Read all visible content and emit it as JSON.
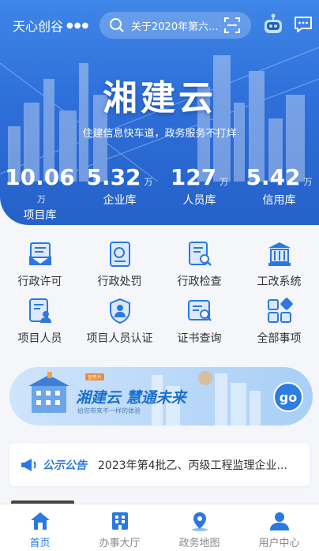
{
  "header": {
    "location": "天心创谷",
    "search_text": "关于2020年第六...",
    "icons": [
      "search-icon",
      "scan-icon",
      "robot-icon",
      "chat-icon"
    ]
  },
  "brand": {
    "title": "湘建云",
    "slogan": "住建信息快车道，政务服务不打烊"
  },
  "stats": [
    {
      "value": "10.06",
      "unit": "万",
      "label": "项目库"
    },
    {
      "value": "5.32",
      "unit": "万",
      "label": "企业库"
    },
    {
      "value": "127",
      "unit": "万",
      "label": "人员库"
    },
    {
      "value": "5.42",
      "unit": "万",
      "label": "信用库"
    }
  ],
  "services": [
    {
      "label": "行政许可",
      "icon": "license-icon"
    },
    {
      "label": "行政处罚",
      "icon": "penalty-icon"
    },
    {
      "label": "行政检查",
      "icon": "inspection-icon"
    },
    {
      "label": "工改系统",
      "icon": "government-building-icon"
    },
    {
      "label": "项目人员",
      "icon": "project-staff-icon"
    },
    {
      "label": "项目人员认证",
      "icon": "staff-verify-icon"
    },
    {
      "label": "证书查询",
      "icon": "certificate-search-icon"
    },
    {
      "label": "全部事项",
      "icon": "all-items-icon"
    }
  ],
  "banner": {
    "tag": "宣传片",
    "title": "湘建云  慧通未来",
    "subtitle": "给您带来不一样的体验",
    "go_label": "go"
  },
  "notice": {
    "badge": "公示公告",
    "text": "2023年第4批乙、丙级工程监理企业..."
  },
  "nav": [
    {
      "label": "首页",
      "icon": "home-icon",
      "active": true
    },
    {
      "label": "办事大厅",
      "icon": "office-hall-icon",
      "active": false
    },
    {
      "label": "政务地图",
      "icon": "map-pin-icon",
      "active": false
    },
    {
      "label": "用户中心",
      "icon": "user-icon",
      "active": false
    }
  ],
  "colors": {
    "primary": "#2a78e0",
    "hero": "#2e6fd9",
    "inactive": "#888888"
  }
}
